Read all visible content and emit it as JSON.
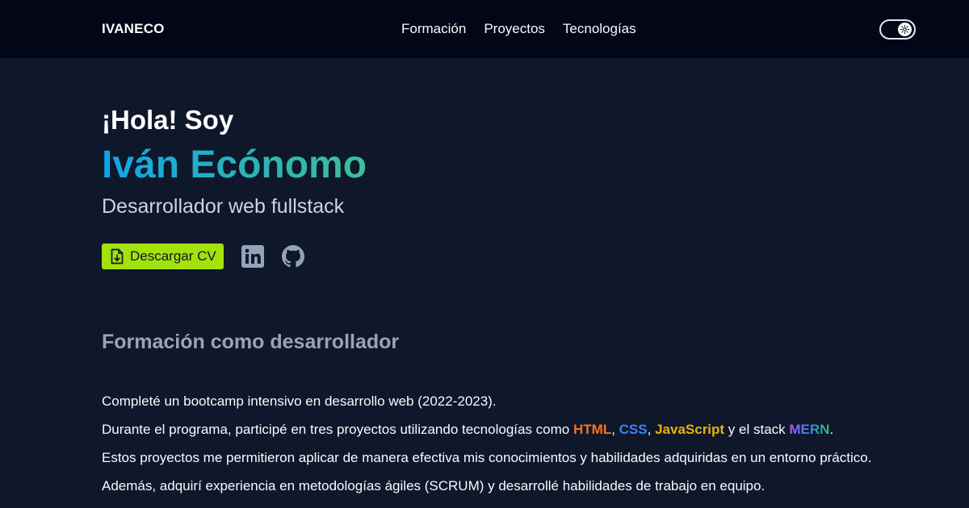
{
  "navbar": {
    "brand": "IVANECO",
    "links": [
      "Formación",
      "Proyectos",
      "Tecnologías"
    ],
    "theme_toggle_icon": "sun-icon"
  },
  "hero": {
    "greeting": "¡Hola! Soy",
    "name": "Iván Ecónomo",
    "role": "Desarrollador web fullstack",
    "cv_button_label": "Descargar CV",
    "cv_button_icon": "file-download-icon",
    "social_icons": [
      "linkedin-icon",
      "github-icon"
    ]
  },
  "formation": {
    "title": "Formación como desarrollador",
    "p1": "Completé un bootcamp intensivo en desarrollo web (2022-2023).",
    "p2": {
      "lead": "Durante el programa, participé en tres proyectos utilizando tecnologías como ",
      "html": "HTML",
      "sep1": ", ",
      "css": "CSS",
      "sep2": ", ",
      "js": "JavaScript",
      "mid": " y el stack ",
      "mern": "MERN",
      "end": "."
    },
    "p3": "Estos proyectos me permitieron aplicar de manera efectiva mis conocimientos y habilidades adquiridas en un entorno práctico.",
    "p4": "Además, adquirí experiencia en metodologías ágiles (SCRUM) y desarrollé habilidades de trabajo en equipo."
  },
  "colors": {
    "background": "#0f172a",
    "navbar": "#020617",
    "accent_button": "#a3e20c",
    "html": "#f97316",
    "css": "#3b82f6",
    "javascript": "#eab308"
  }
}
